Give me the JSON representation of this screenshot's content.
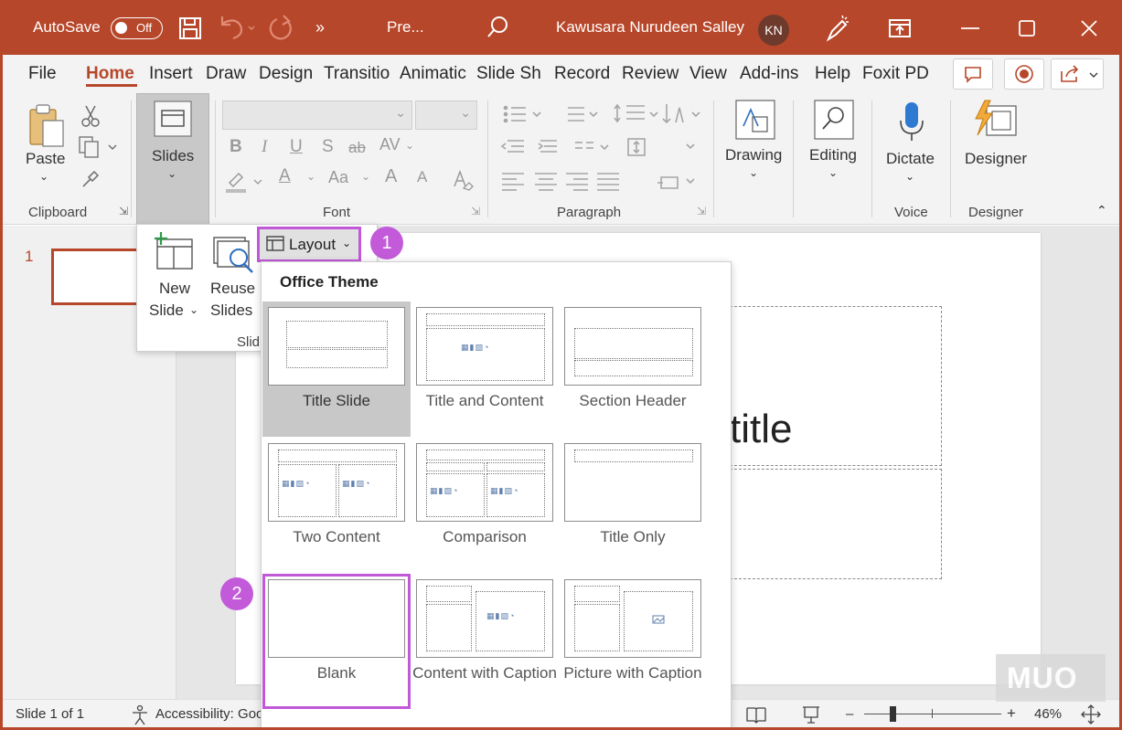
{
  "colors": {
    "accent": "#b7472a",
    "callout": "#c25ad9",
    "selected_layout_bg": "#c8c8c8"
  },
  "titlebar": {
    "autosave_label": "AutoSave",
    "autosave_state": "Off",
    "doc_title": "Pre...",
    "user_name": "Kawusara Nurudeen Salley",
    "avatar_initials": "KN",
    "more_label": "»"
  },
  "tabs": [
    "File",
    "Home",
    "Insert",
    "Draw",
    "Design",
    "Transitio",
    "Animatic",
    "Slide Sh​",
    "Record",
    "Review",
    "View",
    "Add-ins",
    "Help",
    "Foxit PD"
  ],
  "ribbon": {
    "clipboard": {
      "paste_label": "Paste",
      "group_label": "Clipboard"
    },
    "slides": {
      "button_label": "Slides"
    },
    "font": {
      "group_label": "Font",
      "bold": "B",
      "italic": "I",
      "underline": "U",
      "shadow": "S",
      "strike": "ab",
      "spacing": "AV",
      "case": "Aa",
      "grow": "A",
      "shrink": "A",
      "font_color": "A"
    },
    "paragraph": {
      "group_label": "Paragraph"
    },
    "drawing": {
      "label": "Drawing"
    },
    "editing": {
      "label": "Editing"
    },
    "voice": {
      "dictate_label": "Dictate",
      "group_label": "Voice"
    },
    "designer": {
      "label": "Designer",
      "group_label": "Designer"
    }
  },
  "slides_popup": {
    "new_slide_line1": "New",
    "new_slide_line2": "Slide",
    "reuse_line1": "Reuse",
    "reuse_line2": "Slides",
    "group_label_partial": "Slid",
    "layout_button": "Layout"
  },
  "callouts": {
    "first": "1",
    "second": "2"
  },
  "gallery": {
    "title": "Office Theme",
    "layouts": [
      {
        "name": "Title Slide",
        "state": "selected"
      },
      {
        "name": "Title and Content",
        "state": "normal"
      },
      {
        "name": "Section Header",
        "state": "normal"
      },
      {
        "name": "Two Content",
        "state": "normal"
      },
      {
        "name": "Comparison",
        "state": "normal"
      },
      {
        "name": "Title Only",
        "state": "normal"
      },
      {
        "name": "Blank",
        "state": "highlighted"
      },
      {
        "name": "Content with Caption",
        "state": "normal"
      },
      {
        "name": "Picture with Caption",
        "state": "normal"
      }
    ]
  },
  "thumbnails": {
    "slide_number": "1"
  },
  "slide": {
    "visible_title_fragment": "title"
  },
  "statusbar": {
    "slide_count": "Slide 1 of 1",
    "accessibility": "Accessibility: Goo",
    "zoom_level": "46%",
    "zoom_minus": "–",
    "zoom_plus": "+"
  },
  "watermark": "MUO"
}
